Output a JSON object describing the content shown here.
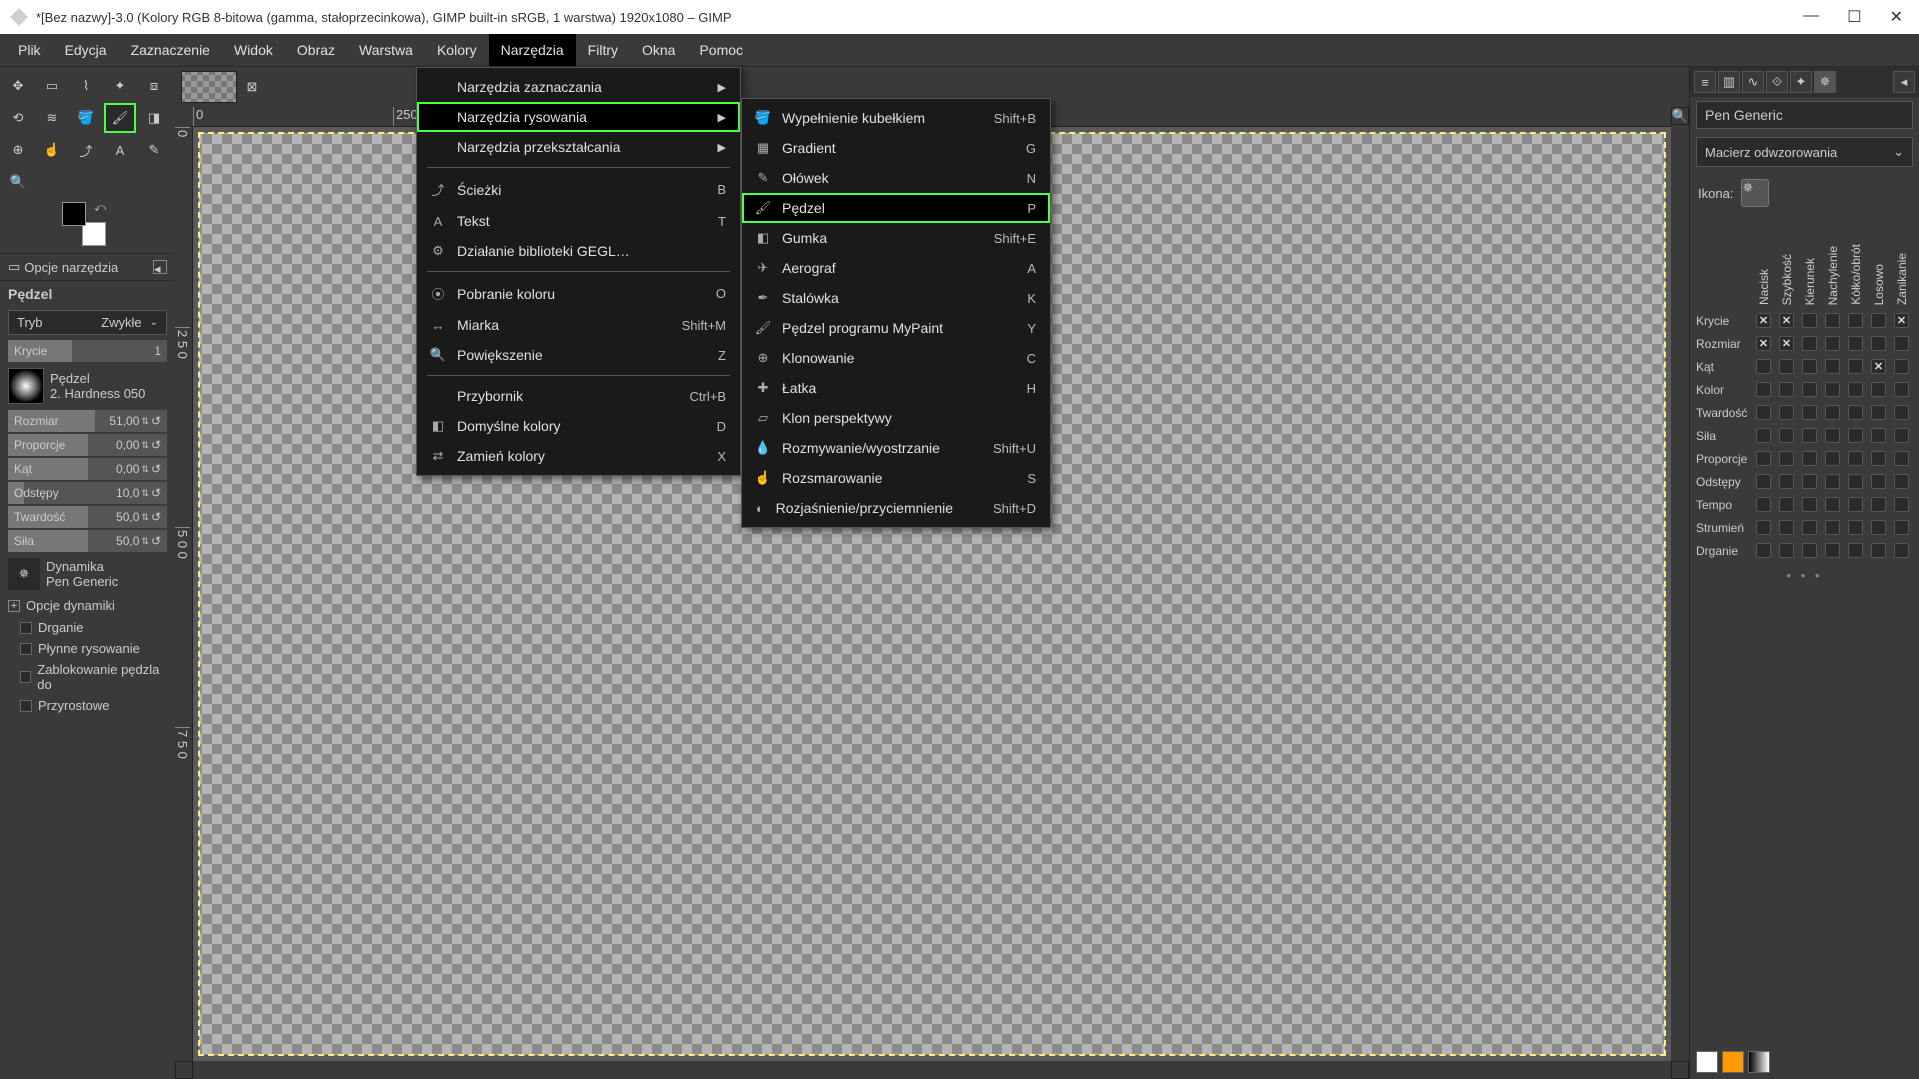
{
  "title": "*[Bez nazwy]-3.0 (Kolory RGB 8-bitowa (gamma, stałoprzecinkowa), GIMP built-in sRGB, 1 warstwa) 1920x1080 – GIMP",
  "menubar": [
    "Plik",
    "Edycja",
    "Zaznaczenie",
    "Widok",
    "Obraz",
    "Warstwa",
    "Kolory",
    "Narzędzia",
    "Filtry",
    "Okna",
    "Pomoc"
  ],
  "menubar_active_index": 7,
  "tools_menu": [
    {
      "label": "Narzędzia zaznaczania",
      "sub": true
    },
    {
      "label": "Narzędzia rysowania",
      "sub": true,
      "hl": true
    },
    {
      "label": "Narzędzia przekształcania",
      "sub": true
    },
    {
      "sep": true
    },
    {
      "label": "Ścieżki",
      "short": "B",
      "icon": "⤴"
    },
    {
      "label": "Tekst",
      "short": "T",
      "icon": "A"
    },
    {
      "label": "Działanie biblioteki GEGL…",
      "icon": "⚙"
    },
    {
      "sep": true
    },
    {
      "label": "Pobranie koloru",
      "short": "O",
      "icon": "⦿"
    },
    {
      "label": "Miarka",
      "short": "Shift+M",
      "icon": "↔"
    },
    {
      "label": "Powiększenie",
      "short": "Z",
      "icon": "🔍"
    },
    {
      "sep": true
    },
    {
      "label": "Przybornik",
      "short": "Ctrl+B"
    },
    {
      "label": "Domyślne kolory",
      "short": "D",
      "icon": "◧"
    },
    {
      "label": "Zamień kolory",
      "short": "X",
      "icon": "⇄"
    }
  ],
  "draw_menu": [
    {
      "label": "Wypełnienie kubełkiem",
      "short": "Shift+B",
      "icon": "🪣"
    },
    {
      "label": "Gradient",
      "short": "G",
      "icon": "▦"
    },
    {
      "label": "Ołówek",
      "short": "N",
      "icon": "✎"
    },
    {
      "label": "Pędzel",
      "short": "P",
      "icon": "🖌",
      "hl": true
    },
    {
      "label": "Gumka",
      "short": "Shift+E",
      "icon": "◧"
    },
    {
      "label": "Aerograf",
      "short": "A",
      "icon": "✈"
    },
    {
      "label": "Stalówka",
      "short": "K",
      "icon": "✒"
    },
    {
      "label": "Pędzel programu MyPaint",
      "short": "Y",
      "icon": "🖌"
    },
    {
      "label": "Klonowanie",
      "short": "C",
      "icon": "⊕"
    },
    {
      "label": "Łatka",
      "short": "H",
      "icon": "✚"
    },
    {
      "label": "Klon perspektywy",
      "icon": "▱"
    },
    {
      "label": "Rozmywanie/wyostrzanie",
      "short": "Shift+U",
      "icon": "💧"
    },
    {
      "label": "Rozsmarowanie",
      "short": "S",
      "icon": "☝"
    },
    {
      "label": "Rozjaśnienie/przyciemnienie",
      "short": "Shift+D",
      "icon": "◐"
    }
  ],
  "left": {
    "options_title": "Opcje narzędzia",
    "tool_name": "Pędzel",
    "mode_label": "Tryb",
    "mode_value": "Zwykłe",
    "opacity_label": "Krycie",
    "opacity_value": "1",
    "brush_label": "Pędzel",
    "brush_name": "2. Hardness 050",
    "size_label": "Rozmiar",
    "size_value": "51,00",
    "ratio_label": "Proporcje",
    "ratio_value": "0,00",
    "angle_label": "Kąt",
    "angle_value": "0,00",
    "spacing_label": "Odstępy",
    "spacing_value": "10,0",
    "hardness_label": "Twardość",
    "hardness_value": "50,0",
    "force_label": "Siła",
    "force_value": "50,0",
    "dyn_label": "Dynamika",
    "dyn_value": "Pen Generic",
    "exp_dyn": "Opcje dynamiki",
    "chk_jitter": "Drganie",
    "chk_smooth": "Płynne rysowanie",
    "chk_lock": "Zablokowanie pędzla do",
    "chk_inc": "Przyrostowe"
  },
  "right": {
    "name": "Pen Generic",
    "mapping": "Macierz odwzorowania",
    "icon_label": "Ikona:",
    "cols": [
      "Nacisk",
      "Szybkość",
      "Kierunek",
      "Nachylenie",
      "Kółko/obrót",
      "Losowo",
      "Zanikanie"
    ],
    "rows": [
      {
        "label": "Krycie",
        "checks": [
          1,
          1,
          0,
          0,
          0,
          0,
          1
        ]
      },
      {
        "label": "Rozmiar",
        "checks": [
          1,
          1,
          0,
          0,
          0,
          0,
          0
        ]
      },
      {
        "label": "Kąt",
        "checks": [
          0,
          0,
          0,
          0,
          0,
          1,
          0
        ]
      },
      {
        "label": "Kolor",
        "checks": [
          0,
          0,
          0,
          0,
          0,
          0,
          0
        ]
      },
      {
        "label": "Twardość",
        "checks": [
          0,
          0,
          0,
          0,
          0,
          0,
          0
        ]
      },
      {
        "label": "Siła",
        "checks": [
          0,
          0,
          0,
          0,
          0,
          0,
          0
        ]
      },
      {
        "label": "Proporcje",
        "checks": [
          0,
          0,
          0,
          0,
          0,
          0,
          0
        ]
      },
      {
        "label": "Odstępy",
        "checks": [
          0,
          0,
          0,
          0,
          0,
          0,
          0
        ]
      },
      {
        "label": "Tempo",
        "checks": [
          0,
          0,
          0,
          0,
          0,
          0,
          0
        ]
      },
      {
        "label": "Strumień",
        "checks": [
          0,
          0,
          0,
          0,
          0,
          0,
          0
        ]
      },
      {
        "label": "Drganie",
        "checks": [
          0,
          0,
          0,
          0,
          0,
          0,
          0
        ]
      }
    ]
  },
  "ruler_marks": [
    "0",
    "250"
  ],
  "vruler_marks": [
    "0",
    "2 5 0",
    "5 0 0",
    "7 5 0"
  ]
}
